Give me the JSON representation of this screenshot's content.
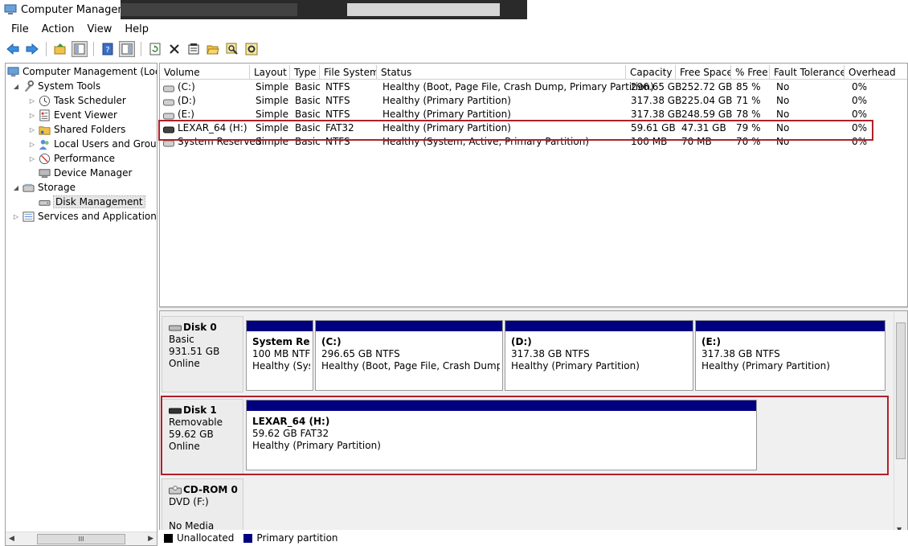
{
  "window": {
    "title": "Computer Management"
  },
  "menu": [
    "File",
    "Action",
    "View",
    "Help"
  ],
  "toolbar": {
    "icons": [
      "back-arrow-icon",
      "forward-arrow-icon",
      "up-folder-icon",
      "show-hide-tree-icon",
      "help-icon",
      "show-hide-action-pane-icon",
      "refresh-icon",
      "delete-icon",
      "properties-icon",
      "open-icon",
      "search-icon",
      "settings-icon"
    ]
  },
  "tree": {
    "root": "Computer Management (Local",
    "system_tools": "System Tools",
    "task_scheduler": "Task Scheduler",
    "event_viewer": "Event Viewer",
    "shared_folders": "Shared Folders",
    "local_users": "Local Users and Groups",
    "performance": "Performance",
    "device_manager": "Device Manager",
    "storage": "Storage",
    "disk_management": "Disk Management",
    "services": "Services and Applications",
    "hscroll_thumb": "III"
  },
  "volume_list": {
    "columns": [
      "Volume",
      "Layout",
      "Type",
      "File System",
      "Status",
      "Capacity",
      "Free Space",
      "% Free",
      "Fault Tolerance",
      "Overhead"
    ],
    "rows": [
      {
        "volume": "(C:)",
        "layout": "Simple",
        "type": "Basic",
        "fs": "NTFS",
        "status": "Healthy (Boot, Page File, Crash Dump, Primary Partition)",
        "capacity": "296.65 GB",
        "free": "252.72 GB",
        "pct": "85 %",
        "fault": "No",
        "overhead": "0%",
        "icon": "drive-icon"
      },
      {
        "volume": "(D:)",
        "layout": "Simple",
        "type": "Basic",
        "fs": "NTFS",
        "status": "Healthy (Primary Partition)",
        "capacity": "317.38 GB",
        "free": "225.04 GB",
        "pct": "71 %",
        "fault": "No",
        "overhead": "0%",
        "icon": "drive-icon"
      },
      {
        "volume": "(E:)",
        "layout": "Simple",
        "type": "Basic",
        "fs": "NTFS",
        "status": "Healthy (Primary Partition)",
        "capacity": "317.38 GB",
        "free": "248.59 GB",
        "pct": "78 %",
        "fault": "No",
        "overhead": "0%",
        "icon": "drive-icon"
      },
      {
        "volume": "LEXAR_64 (H:)",
        "layout": "Simple",
        "type": "Basic",
        "fs": "FAT32",
        "status": "Healthy (Primary Partition)",
        "capacity": "59.61 GB",
        "free": "47.31 GB",
        "pct": "79 %",
        "fault": "No",
        "overhead": "0%",
        "icon": "removable-drive-icon"
      },
      {
        "volume": "System Reserved",
        "layout": "Simple",
        "type": "Basic",
        "fs": "NTFS",
        "status": "Healthy (System, Active, Primary Partition)",
        "capacity": "100 MB",
        "free": "70 MB",
        "pct": "70 %",
        "fault": "No",
        "overhead": "0%",
        "icon": "drive-icon"
      }
    ]
  },
  "disks": {
    "disk0": {
      "name": "Disk 0",
      "kind": "Basic",
      "size": "931.51 GB",
      "state": "Online",
      "partitions": [
        {
          "name": "System Rese",
          "detail": "100 MB NTFS",
          "status": "Healthy (Syst"
        },
        {
          "name": "(C:)",
          "detail": "296.65 GB NTFS",
          "status": "Healthy (Boot, Page File, Crash Dump, Pri"
        },
        {
          "name": "(D:)",
          "detail": "317.38 GB NTFS",
          "status": "Healthy (Primary Partition)"
        },
        {
          "name": "(E:)",
          "detail": "317.38 GB NTFS",
          "status": "Healthy (Primary Partition)"
        }
      ]
    },
    "disk1": {
      "name": "Disk 1",
      "kind": "Removable",
      "size": "59.62 GB",
      "state": "Online",
      "partitions": [
        {
          "name": "LEXAR_64  (H:)",
          "detail": "59.62 GB FAT32",
          "status": "Healthy (Primary Partition)"
        }
      ]
    },
    "cdrom0": {
      "name": "CD-ROM 0",
      "kind": "DVD (F:)",
      "state": "No Media"
    }
  },
  "legend": {
    "unallocated": "Unallocated",
    "primary": "Primary partition",
    "unallocated_color": "#000000",
    "primary_color": "#00007f"
  }
}
